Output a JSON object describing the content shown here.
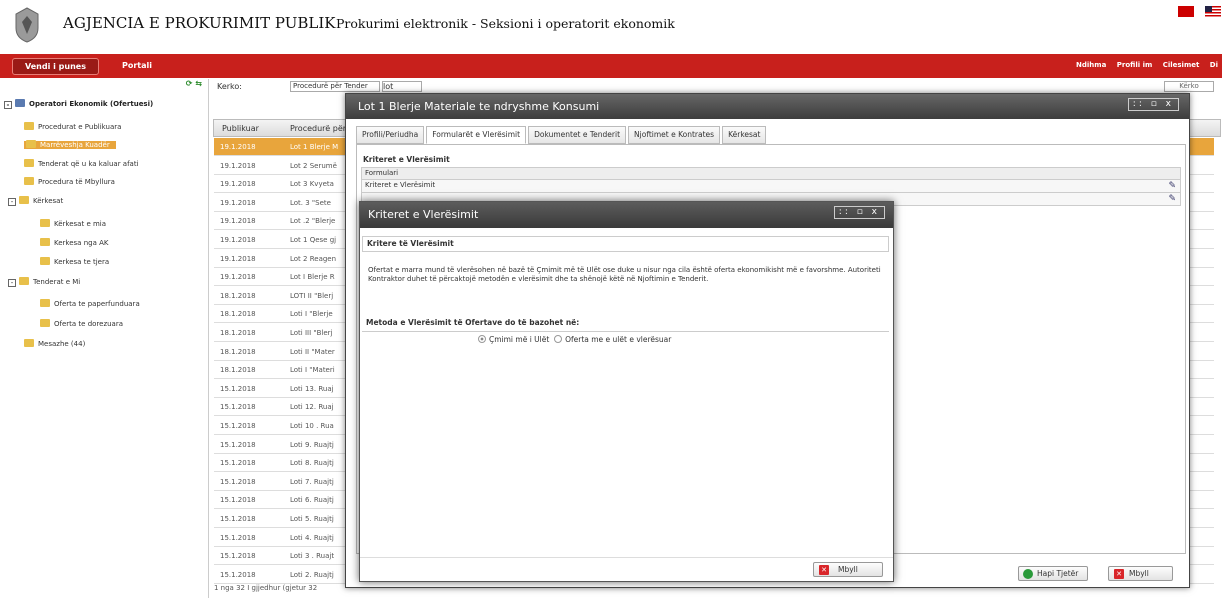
{
  "header": {
    "agency": "AGJENCIA E PROKURIMIT PUBLIK",
    "subtitle": "Prokurimi elektronik - Seksioni i operatorit ekonomik",
    "flag_colors": {
      "al": "#cc0000",
      "us": "#cc0000"
    }
  },
  "nav": {
    "tab_active": "Vendi i punes",
    "tab_portali": "Portali",
    "links": [
      "Ndihma",
      "Profili im",
      "Cilesimet",
      "Di"
    ]
  },
  "sidebar": {
    "root": "Operatori Ekonomik (Ofertuesi)",
    "items": [
      "Procedurat e Publikuara",
      "Marrëveshja Kuadër",
      "Tenderat që u ka kaluar afati",
      "Procedura të Mbyllura"
    ],
    "kerkesat": "Kërkesat",
    "kerkesat_items": [
      "Kërkesat e mia",
      "Kerkesa nga AK",
      "Kerkesa te tjera"
    ],
    "tenderat": "Tenderat e Mi",
    "tenderat_items": [
      "Oferta te paperfunduara",
      "Oferta te dorezuara"
    ],
    "mesazhe": "Mesazhe (44)"
  },
  "search": {
    "label": "Kerko:",
    "select_value": "Procedurë për Tender",
    "input_value": "lot",
    "button": "Kërko"
  },
  "grid": {
    "columns": [
      "Publikuar",
      "Procedurë për Tender"
    ],
    "rows": [
      {
        "date": "19.1.2018",
        "name": "Lot 1 Blerje M"
      },
      {
        "date": "19.1.2018",
        "name": "Lot 2 Serumë"
      },
      {
        "date": "19.1.2018",
        "name": "Lot 3 Kvyeta"
      },
      {
        "date": "19.1.2018",
        "name": "Lot. 3 \"Sete"
      },
      {
        "date": "19.1.2018",
        "name": "Lot .2 \"Blerje"
      },
      {
        "date": "19.1.2018",
        "name": "Lot 1 Qese gj"
      },
      {
        "date": "19.1.2018",
        "name": "Lot 2 Reagen"
      },
      {
        "date": "19.1.2018",
        "name": "Lot I Blerje R"
      },
      {
        "date": "18.1.2018",
        "name": "LOTI II \"Blerj"
      },
      {
        "date": "18.1.2018",
        "name": "Loti I \"Blerje"
      },
      {
        "date": "18.1.2018",
        "name": "Loti III \"Blerj"
      },
      {
        "date": "18.1.2018",
        "name": "Loti II \"Mater"
      },
      {
        "date": "18.1.2018",
        "name": "Loti I \"Materi"
      },
      {
        "date": "15.1.2018",
        "name": "Loti 13. Ruaj"
      },
      {
        "date": "15.1.2018",
        "name": "Loti 12. Ruaj"
      },
      {
        "date": "15.1.2018",
        "name": "Loti 10 . Rua"
      },
      {
        "date": "15.1.2018",
        "name": "Loti 9. Ruajtj"
      },
      {
        "date": "15.1.2018",
        "name": "Loti 8. Ruajtj"
      },
      {
        "date": "15.1.2018",
        "name": "Loti 7. Ruajtj"
      },
      {
        "date": "15.1.2018",
        "name": "Loti 6. Ruajtj"
      },
      {
        "date": "15.1.2018",
        "name": "Loti 5. Ruajtj"
      },
      {
        "date": "15.1.2018",
        "name": "Loti 4. Ruajtj"
      },
      {
        "date": "15.1.2018",
        "name": "Loti 3 . Ruajt"
      },
      {
        "date": "15.1.2018",
        "name": "Loti 2. Ruajtj"
      }
    ],
    "footer": "1 nga 32 I gjjedhur (gjetur 32"
  },
  "lot_dialog": {
    "title": "Lot 1 Blerje Materiale te ndryshme Konsumi",
    "tabs": [
      "Profili/Periudha",
      "Formularët e Vlerësimit",
      "Dokumentet e Tenderit",
      "Njoftimet e Kontrates",
      "Kërkesat"
    ],
    "section": "Kriteret e Vlerësimit",
    "table": [
      "Formulari",
      "Kriteret e Vlerësimit",
      ""
    ],
    "btn_hapi": "Hapi Tjetër",
    "btn_mbyll": "Mbyll"
  },
  "kv_dialog": {
    "title": "Kriteret e Vlerësimit",
    "section1": "Kritere të Vlerësimit",
    "description": "Ofertat e marra mund të vlerësohen në bazë të Çmimit më të Ulët ose duke u nisur nga cila është oferta ekonomikisht më e favorshme. Autoriteti Kontraktor duhet të përcaktojë metodën e vlerësimit dhe ta shënojë këtë në Njoftimin e Tenderit.",
    "section2": "Metoda e Vlerësimit të Ofertave do të bazohet në:",
    "radio1": "Çmimi më i Ulët",
    "radio2": "Oferta me e ulët e vlerësuar",
    "btn_mbyll": "Mbyll"
  }
}
